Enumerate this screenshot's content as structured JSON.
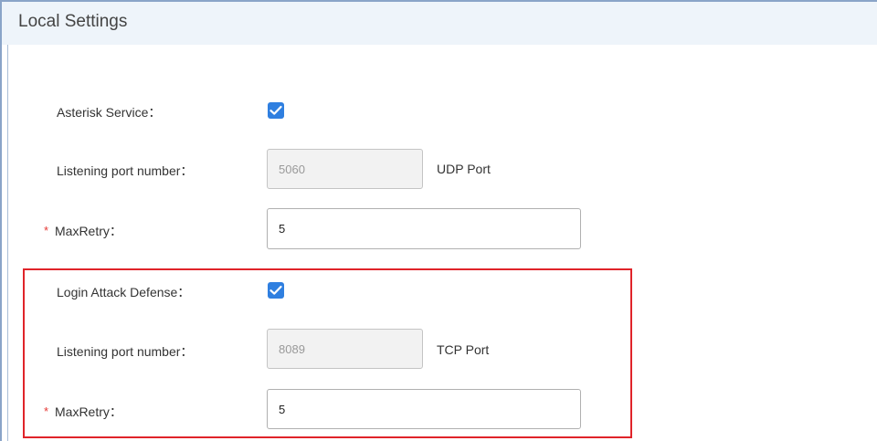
{
  "panel": {
    "title": "Local Settings"
  },
  "section_main": {
    "asterisk_service_label": "Asterisk Service：",
    "asterisk_service_checked": true,
    "listening_port_label": "Listening port number：",
    "listening_port_value": "5060",
    "listening_port_suffix": "UDP Port",
    "maxretry_required_mark": "*",
    "maxretry_label": "MaxRetry：",
    "maxretry_value": "5"
  },
  "section_login": {
    "login_attack_label": "Login Attack Defense：",
    "login_attack_checked": true,
    "listening_port_label": "Listening port number：",
    "listening_port_value": "8089",
    "listening_port_suffix": "TCP Port",
    "maxretry_required_mark": "*",
    "maxretry_label": "MaxRetry：",
    "maxretry_value": "5"
  },
  "colors": {
    "checkbox": "#2f7fe0",
    "highlight": "#e0242a",
    "required": "#e53935",
    "header_bg": "#eef4fa"
  }
}
